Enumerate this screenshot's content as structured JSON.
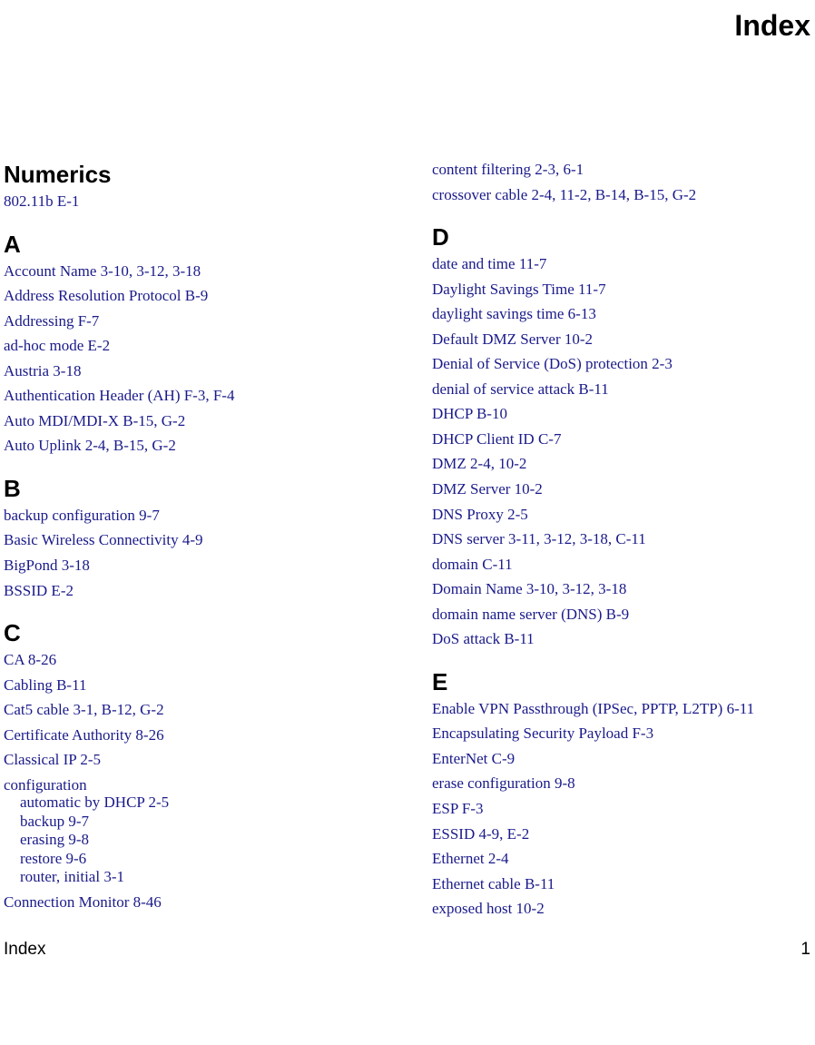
{
  "page_title": "Index",
  "footer_left": "Index",
  "footer_right": "1",
  "left_sections": [
    {
      "header": "Numerics",
      "entries": [
        {
          "text": "802.11b  E-1"
        }
      ]
    },
    {
      "header": "A",
      "entries": [
        {
          "text": "Account Name  3-10, 3-12, 3-18"
        },
        {
          "text": "Address Resolution Protocol  B-9"
        },
        {
          "text": "Addressing  F-7"
        },
        {
          "text": "ad-hoc mode  E-2"
        },
        {
          "text": "Austria  3-18"
        },
        {
          "text": "Authentication Header (AH)  F-3, F-4"
        },
        {
          "text": "Auto MDI/MDI-X  B-15, G-2"
        },
        {
          "text": "Auto Uplink  2-4, B-15, G-2"
        }
      ]
    },
    {
      "header": "B",
      "entries": [
        {
          "text": "backup configuration  9-7"
        },
        {
          "text": "Basic Wireless Connectivity  4-9"
        },
        {
          "text": "BigPond  3-18"
        },
        {
          "text": "BSSID  E-2"
        }
      ]
    },
    {
      "header": "C",
      "entries": [
        {
          "text": "CA  8-26"
        },
        {
          "text": "Cabling  B-11"
        },
        {
          "text": "Cat5 cable  3-1, B-12, G-2"
        },
        {
          "text": "Certificate Authority  8-26"
        },
        {
          "text": "Classical IP  2-5"
        },
        {
          "text": "configuration",
          "subs": [
            "automatic by DHCP  2-5",
            "backup  9-7",
            "erasing  9-8",
            "restore  9-6",
            "router, initial  3-1"
          ]
        },
        {
          "text": "Connection Monitor  8-46"
        }
      ]
    }
  ],
  "right_sections": [
    {
      "header": "",
      "entries": [
        {
          "text": "content filtering  2-3, 6-1"
        },
        {
          "text": "crossover cable  2-4, 11-2, B-14, B-15, G-2"
        }
      ]
    },
    {
      "header": "D",
      "entries": [
        {
          "text": "date and time  11-7"
        },
        {
          "text": "Daylight Savings Time  11-7"
        },
        {
          "text": "daylight savings time  6-13"
        },
        {
          "text": "Default DMZ Server  10-2"
        },
        {
          "text": "Denial of Service (DoS) protection  2-3"
        },
        {
          "text": "denial of service attack  B-11"
        },
        {
          "text": "DHCP  B-10"
        },
        {
          "text": "DHCP Client ID  C-7"
        },
        {
          "text": "DMZ  2-4, 10-2"
        },
        {
          "text": "DMZ Server  10-2"
        },
        {
          "text": "DNS Proxy  2-5"
        },
        {
          "text": "DNS server  3-11, 3-12, 3-18, C-11"
        },
        {
          "text": "domain  C-11"
        },
        {
          "text": "Domain Name  3-10, 3-12, 3-18"
        },
        {
          "text": "domain name server (DNS)  B-9"
        },
        {
          "text": "DoS attack  B-11"
        }
      ]
    },
    {
      "header": "E",
      "entries": [
        {
          "text": "Enable VPN Passthrough (IPSec, PPTP, L2TP)  6-11"
        },
        {
          "text": "Encapsulating Security Payload  F-3"
        },
        {
          "text": "EnterNet  C-9"
        },
        {
          "text": "erase configuration  9-8"
        },
        {
          "text": "ESP  F-3"
        },
        {
          "text": "ESSID  4-9, E-2"
        },
        {
          "text": "Ethernet  2-4"
        },
        {
          "text": "Ethernet cable  B-11"
        },
        {
          "text": "exposed host  10-2"
        }
      ]
    }
  ]
}
